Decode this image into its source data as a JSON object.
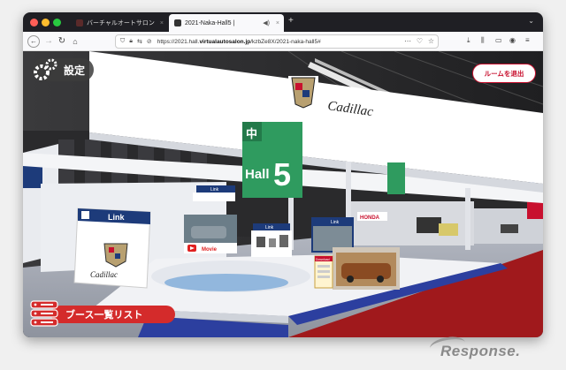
{
  "browser": {
    "tabs": [
      {
        "title": "バーチャルオートサロン",
        "close": "×"
      },
      {
        "title": "2021-Naka-Hall5 |",
        "close": "×"
      }
    ],
    "new_tab": "+",
    "address": {
      "prefix": "https://2021.hall.",
      "domain": "virtualautosalon.jp",
      "path": "/kzbZe8X/2021-naka-hall5#"
    }
  },
  "overlay": {
    "settings_label": "設定",
    "exit_label": "ルームを退出",
    "booth_list_label": "ブース一覧リスト"
  },
  "scene": {
    "hall_kanji": "中",
    "hall_word": "Hall",
    "hall_number": "5",
    "brand_wordmark": "Cadillac",
    "link_label": "Link",
    "movie_label": "Movie",
    "download_label": "Download",
    "honda_label": "HONDA",
    "colors": {
      "hall_green": "#2f9b5f",
      "accent_red": "#c8102e",
      "link_navy": "#1d3b7a",
      "carpet_blue": "#2c3f9f"
    }
  },
  "watermark": "Response."
}
